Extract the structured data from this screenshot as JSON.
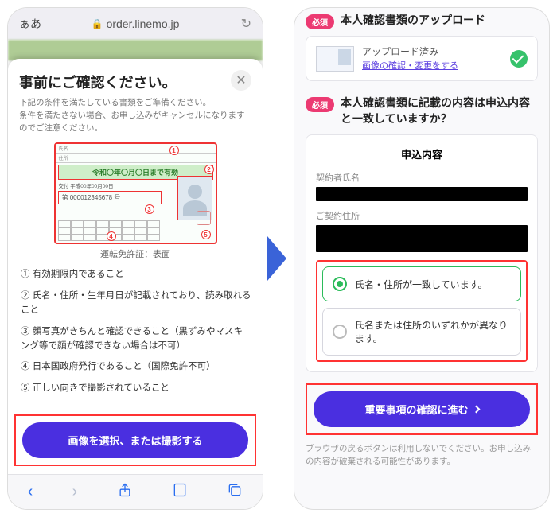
{
  "left": {
    "browser": {
      "aa": "ぁあ",
      "lock": "🔒",
      "url": "order.linemo.jp",
      "reload": "↻"
    },
    "sheet": {
      "title": "事前にご確認ください。",
      "note": "下記の条件を満たしている書類をご準備ください。\n条件を満たさない場合、お申し込みがキャンセルになりますのでご注意ください。",
      "license": {
        "valid_text": "令和〇年〇月〇日まで有効",
        "number": "第 000012345678 号",
        "caption": "運転免許証：表面"
      },
      "requirements": [
        "① 有効期限内であること",
        "② 氏名・住所・生年月日が記載されており、読み取れること",
        "③ 顔写真がきちんと確認できること（黒ずみやマスキング等で顔が確認できない場合は不可）",
        "④ 日本国政府発行であること（国際免許不可）",
        "⑤ 正しい向きで撮影されていること"
      ],
      "cta": "画像を選択、または撮影する"
    },
    "bottombar": {
      "back": "‹",
      "fwd": "›",
      "share": "⇪",
      "book": "▢",
      "tabs": "❐"
    }
  },
  "right": {
    "section1": {
      "badge": "必須",
      "title": "本人確認書類のアップロード",
      "upload_done": "アップロード済み",
      "upload_link": "画像の確認・変更をする"
    },
    "section2": {
      "badge": "必須",
      "title": "本人確認書類に記載の内容は申込内容と一致していますか？",
      "card_title": "申込内容",
      "field1": "契約者氏名",
      "field2": "ご契約住所",
      "opt1": "氏名・住所が一致しています。",
      "opt2": "氏名または住所のいずれかが異なります。"
    },
    "cta": "重要事項の確認に進む",
    "footer_note": "ブラウザの戻るボタンは利用しないでください。お申し込みの内容が破棄される可能性があります。"
  }
}
